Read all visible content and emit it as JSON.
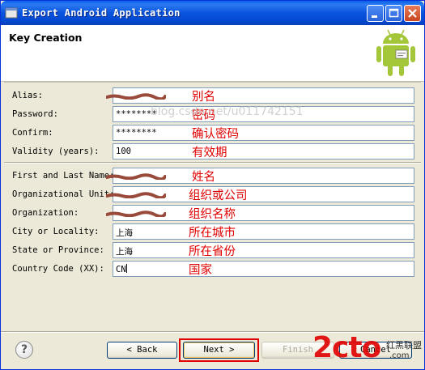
{
  "window": {
    "title": "Export Android Application",
    "controls": [
      "minimize-icon",
      "maximize-icon",
      "close-icon"
    ]
  },
  "header": {
    "title": "Key Creation"
  },
  "form": {
    "fields": [
      {
        "label": "Alias:",
        "value": "",
        "annotation": "别名",
        "obscured": true
      },
      {
        "label": "Password:",
        "value": "********",
        "annotation": "密码"
      },
      {
        "label": "Confirm:",
        "value": "********",
        "annotation": "确认密码"
      },
      {
        "label": "Validity (years):",
        "value": "100",
        "annotation": "有效期"
      },
      {
        "label": "First and Last Name:",
        "value": "",
        "annotation": "姓名",
        "obscured": true
      },
      {
        "label": "Organizational Unit:",
        "value": "",
        "annotation": "组织或公司",
        "obscured": true
      },
      {
        "label": "Organization:",
        "value": "",
        "annotation": "组织名称",
        "obscured": true
      },
      {
        "label": "City or Locality:",
        "value": "上海",
        "annotation": "所在城市"
      },
      {
        "label": "State or Province:",
        "value": "上海",
        "annotation": "所在省份"
      },
      {
        "label": "Country Code (XX):",
        "value": "CN",
        "annotation": "国家"
      }
    ]
  },
  "buttons": {
    "back": "< Back",
    "next": "Next >",
    "finish": "Finish",
    "cancel": "Cancel"
  },
  "watermark": {
    "url": "blog.csdn.net/u011742151",
    "logo": "2cto",
    "site1": "红黑联盟",
    "site2": ".com"
  },
  "colors": {
    "annotation": "#e00000",
    "titlebar": "#0a54de",
    "android_green": "#a4c639"
  }
}
